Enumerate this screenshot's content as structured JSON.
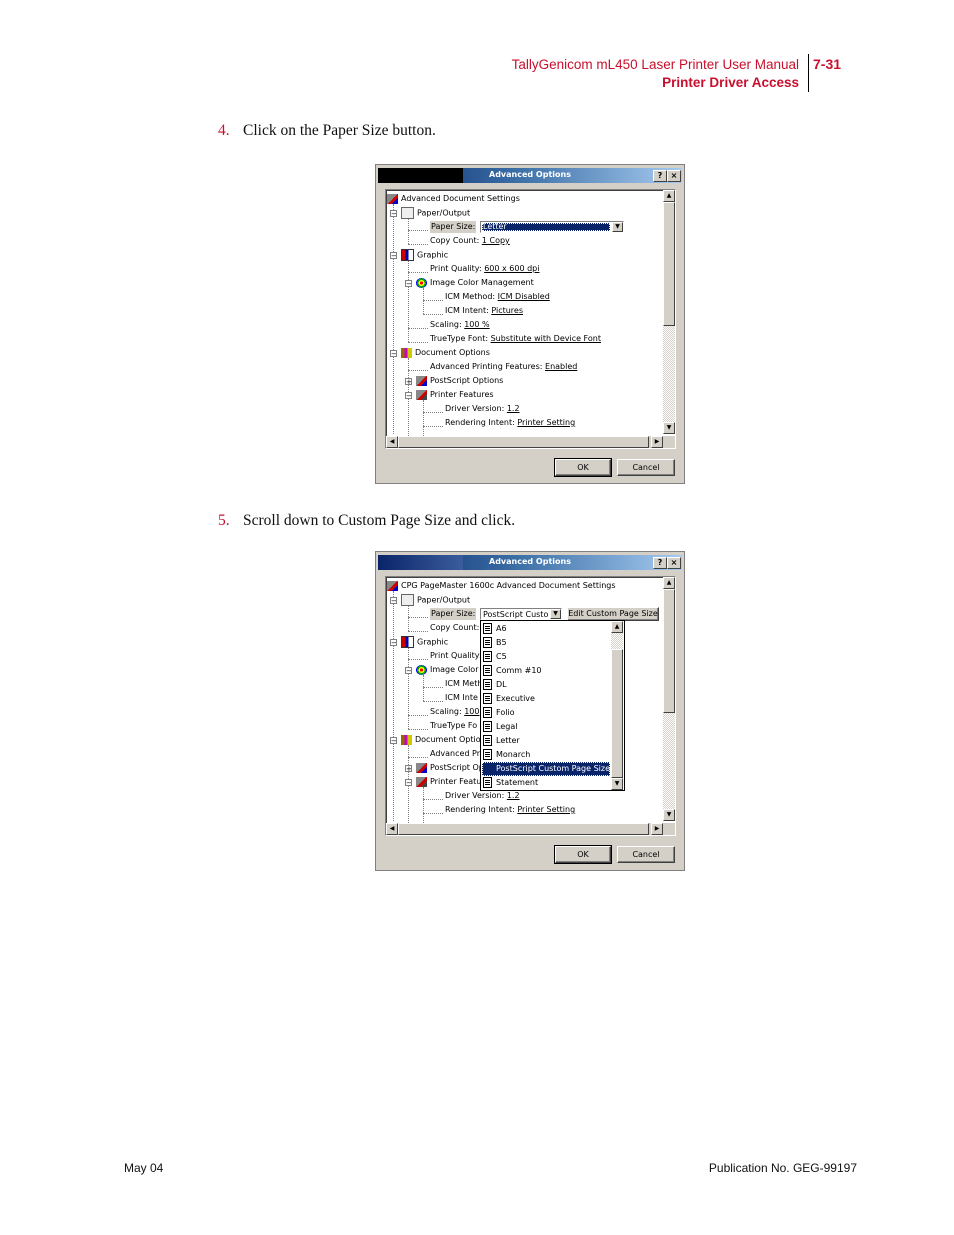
{
  "header": {
    "manual_title": "TallyGenicom mL450 Laser Printer User Manual",
    "section_title": "Printer Driver Access",
    "page_number": "7-31"
  },
  "steps": [
    {
      "number": "4.",
      "text": "Click on the Paper Size button."
    },
    {
      "number": "5.",
      "text": "Scroll down to Custom Page Size and click."
    }
  ],
  "dialog1": {
    "title": "Advanced Options",
    "help_label": "?",
    "close_label": "×",
    "root_label": "Advanced Document Settings",
    "tree": {
      "paper_output": "Paper/Output",
      "paper_size_label": "Paper Size:",
      "paper_size_value": "Letter",
      "copy_count_label": "Copy Count:",
      "copy_count_value": "1 Copy",
      "graphic": "Graphic",
      "print_quality_label": "Print Quality:",
      "print_quality_value": "600 x 600 dpi",
      "icm": "Image Color Management",
      "icm_method_label": "ICM Method:",
      "icm_method_value": "ICM Disabled",
      "icm_intent_label": "ICM Intent:",
      "icm_intent_value": "Pictures",
      "scaling_label": "Scaling:",
      "scaling_value": "100 %",
      "truetype_label": "TrueType Font:",
      "truetype_value": "Substitute with Device Font",
      "document_options": "Document Options",
      "adv_printing_label": "Advanced Printing Features:",
      "adv_printing_value": "Enabled",
      "postscript_options": "PostScript Options",
      "printer_features": "Printer Features",
      "driver_version_label": "Driver Version:",
      "driver_version_value": "1.2",
      "rendering_intent_label": "Rendering Intent:",
      "rendering_intent_value": "Printer Setting"
    },
    "ok_label": "OK",
    "cancel_label": "Cancel"
  },
  "dialog2": {
    "title": "Advanced Options",
    "help_label": "?",
    "close_label": "×",
    "root_label": "CPG PageMaster 1600c Advanced Document Settings",
    "tree": {
      "paper_output": "Paper/Output",
      "paper_size_label": "Paper Size:",
      "paper_size_value": "PostScript Custo",
      "edit_custom_label": "Edit Custom Page Size",
      "copy_count_label": "Copy Count:",
      "graphic": "Graphic",
      "print_quality_label": "Print Quality:",
      "icm": "Image Color",
      "icm_method_label": "ICM Meth",
      "icm_intent_label": "ICM Inte",
      "scaling_label": "Scaling:",
      "scaling_value": "100",
      "truetype_label": "TrueType Fo",
      "document_options": "Document Option",
      "adv_printing_label": "Advanced Pr",
      "postscript_options": "PostScript Op",
      "printer_features": "Printer Featu",
      "driver_version_label": "Driver Version:",
      "driver_version_value": "1.2",
      "rendering_intent_label": "Rendering Intent:",
      "rendering_intent_value": "Printer Setting"
    },
    "paper_sizes": [
      "A6",
      "B5",
      "C5",
      "Comm #10",
      "DL",
      "Executive",
      "Folio",
      "Legal",
      "Letter",
      "Monarch",
      "PostScript Custom Page Size",
      "Statement"
    ],
    "selected_paper_size": "PostScript Custom Page Size",
    "ok_label": "OK",
    "cancel_label": "Cancel"
  },
  "footer": {
    "date": "May 04",
    "publication": "Publication No. GEG-99197"
  }
}
